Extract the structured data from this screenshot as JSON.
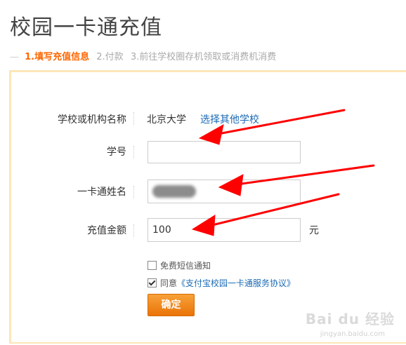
{
  "page": {
    "title": "校园一卡通充值"
  },
  "steps": {
    "dash": "—",
    "active": "1.填写充值信息",
    "step2": "2.付款",
    "step3": "3.前往学校圈存机领取或消费机消费"
  },
  "form": {
    "school": {
      "label": "学校或机构名称",
      "value": "北京大学",
      "change_link": "选择其他学校"
    },
    "student_id": {
      "label": "学号",
      "value": ""
    },
    "name": {
      "label": "一卡通姓名"
    },
    "amount": {
      "label": "充值金额",
      "value": "100",
      "unit": "元"
    },
    "sms": {
      "label": "免费短信通知",
      "checked": false
    },
    "agree": {
      "prefix": "同意",
      "link": "《支付宝校园一卡通服务协议》",
      "checked": true
    },
    "submit_label": "确定"
  },
  "watermark": {
    "brand": "Bai du 经验",
    "url": "jingyan.baidu.com"
  },
  "colors": {
    "accent": "#ff6600",
    "link": "#1a6ab5",
    "button": "#f08a1c",
    "panel_border": "#fde6b8",
    "arrow": "#ff0000"
  }
}
